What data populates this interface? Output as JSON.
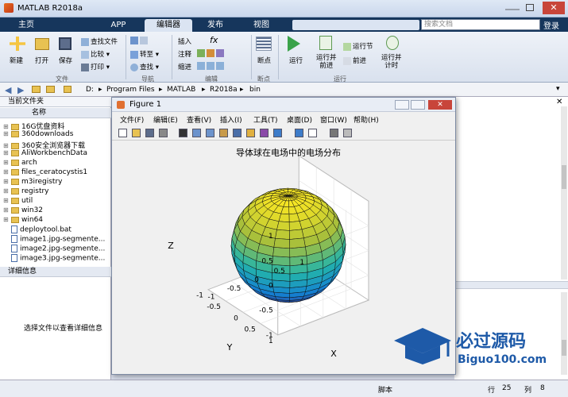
{
  "app": {
    "title": "MATLAB R2018a"
  },
  "tabs": [
    "主页",
    "APP",
    "编辑器",
    "发布",
    "视图"
  ],
  "active_tab": "编辑器",
  "search": {
    "placeholder": "搜索文档"
  },
  "login": "登录",
  "ribbon": {
    "file": {
      "new": "新建",
      "open": "打开",
      "save": "保存",
      "find_files": "查找文件",
      "compare": "比较",
      "print": "打印",
      "group": "文件"
    },
    "navigate": {
      "goto": "转至",
      "find": "查找",
      "group": "导航"
    },
    "edit": {
      "insert": "插入",
      "comment": "注释",
      "indent": "缩进",
      "fx": "fx",
      "group": "编辑"
    },
    "breakpoints": {
      "label": "断点",
      "group": "断点"
    },
    "run": {
      "run": "运行",
      "run_advance": "运行并\n前进",
      "run_section": "运行节",
      "advance": "前进",
      "run_time": "运行并\n计时",
      "group": "运行"
    }
  },
  "address": {
    "crumbs": [
      "D:",
      "Program Files",
      "MATLAB",
      "R2018a",
      "bin"
    ]
  },
  "current_folder": {
    "header": "当前文件夹",
    "column": "名称",
    "items": [
      {
        "name": "16G优盘资料",
        "type": "folder"
      },
      {
        "name": "360downloads",
        "type": "folder"
      },
      {
        "name": "360安全浏览器下载",
        "type": "folder"
      },
      {
        "name": "AliWorkbenchData",
        "type": "folder"
      },
      {
        "name": "arch",
        "type": "folder"
      },
      {
        "name": "files_ceratocystis1",
        "type": "folder"
      },
      {
        "name": "m3iregistry",
        "type": "folder"
      },
      {
        "name": "registry",
        "type": "folder"
      },
      {
        "name": "util",
        "type": "folder"
      },
      {
        "name": "win32",
        "type": "folder"
      },
      {
        "name": "win64",
        "type": "folder"
      },
      {
        "name": "deploytool.bat",
        "type": "file"
      },
      {
        "name": "image1.jpg-segmente...",
        "type": "file"
      },
      {
        "name": "image2.jpg-segmente...",
        "type": "file"
      },
      {
        "name": "image3.jpg-segmente...",
        "type": "file"
      }
    ]
  },
  "details": {
    "header": "详细信息",
    "placeholder": "选择文件以查看详细信息"
  },
  "figure": {
    "title": "Figure 1",
    "menu": [
      "文件(F)",
      "编辑(E)",
      "查看(V)",
      "插入(I)",
      "工具(T)",
      "桌面(D)",
      "窗口(W)",
      "帮助(H)"
    ],
    "plot_title": "导体球在电场中的电场分布",
    "zlabel": "Z",
    "xlabel": "X",
    "ylabel": "Y",
    "z_ticks": [
      "1",
      "0.5",
      "0",
      "-0.5",
      "-1"
    ],
    "x_ticks": [
      "-1",
      "-0.5",
      "0",
      "0.5",
      "1"
    ],
    "y_ticks": [
      "1",
      "0.5",
      "0",
      "-0.5",
      "-1"
    ]
  },
  "status": {
    "script": "脚本",
    "row_label": "行",
    "row": "25",
    "col_label": "列",
    "col": "8"
  },
  "watermark": {
    "line1": "必过源码",
    "line2": "Biguo100.com"
  },
  "colors": {
    "tabbar": "#16365c",
    "sphere_top": "#f9d835",
    "sphere_bottom": "#3b4fb3"
  }
}
